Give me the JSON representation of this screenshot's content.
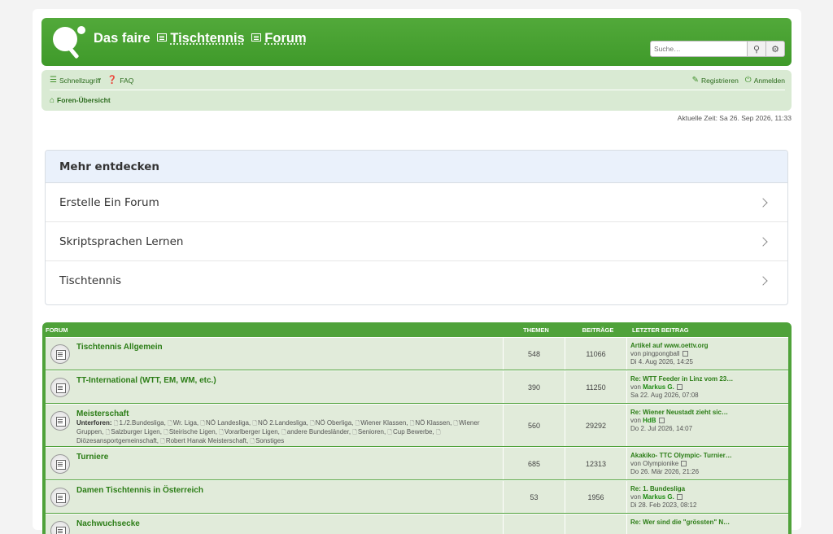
{
  "header": {
    "title_part1": "Das faire",
    "title_part2": "Tischtennis",
    "title_part3": "Forum",
    "search_placeholder": "Suche…"
  },
  "nav": {
    "quicklinks": "Schnellzugriff",
    "faq": "FAQ",
    "register": "Registrieren",
    "login": "Anmelden",
    "breadcrumb": "Foren-Übersicht"
  },
  "current_time": "Aktuelle Zeit: Sa 26. Sep 2026, 11:33",
  "discover": {
    "title": "Mehr entdecken",
    "items": [
      "Erstelle Ein Forum",
      "Skriptsprachen Lernen",
      "Tischtennis"
    ]
  },
  "forum_table": {
    "headers": {
      "forum": "Forum",
      "topics": "Themen",
      "posts": "Beiträge",
      "last": "Letzter Beitrag"
    },
    "rows": [
      {
        "title": "Tischtennis Allgemein",
        "topics": "548",
        "posts": "11066",
        "last_title": "Artikel auf www.oettv.org",
        "by": "von",
        "author": "pingpongball",
        "author_bold": false,
        "date": "Di 4. Aug 2026, 14:25"
      },
      {
        "title": "TT-International (WTT, EM, WM, etc.)",
        "topics": "390",
        "posts": "11250",
        "last_title": "Re: WTT Feeder in Linz vom 23…",
        "by": "von",
        "author": "Markus G.",
        "author_bold": true,
        "date": "Sa 22. Aug 2026, 07:08"
      },
      {
        "title": "Meisterschaft",
        "subforums_label": "Unterforen:",
        "subforums": [
          "1./2.Bundesliga",
          "Wr. Liga",
          "NÖ Landesliga",
          "NÖ 2.Landesliga",
          "NÖ Oberliga",
          "Wiener Klassen",
          "NÖ Klassen",
          "Wiener Gruppen",
          "Salzburger Ligen",
          "Steirische Ligen",
          "Vorarlberger Ligen",
          "andere Bundesländer",
          "Senioren",
          "Cup Bewerbe",
          "Diözesansportgemeinschaft",
          "Robert Hanak Meisterschaft",
          "Sonstiges"
        ],
        "topics": "560",
        "posts": "29292",
        "last_title": "Re: Wiener Neustadt zieht sic…",
        "by": "von",
        "author": "HdB",
        "author_bold": true,
        "date": "Do 2. Jul 2026, 14:07"
      },
      {
        "title": "Turniere",
        "topics": "685",
        "posts": "12313",
        "last_title": "Akakiko- TTC Olympic- Turnier…",
        "by": "von",
        "author": "Olympionike",
        "author_bold": false,
        "date": "Do 26. Mär 2026, 21:26"
      },
      {
        "title": "Damen Tischtennis in Österreich",
        "topics": "53",
        "posts": "1956",
        "last_title": "Re: 1. Bundesliga",
        "by": "von",
        "author": "Markus G.",
        "author_bold": true,
        "date": "Di 28. Feb 2023, 08:12"
      },
      {
        "title": "Nachwuchsecke",
        "topics": "",
        "posts": "",
        "last_title": "Re: Wer sind die \"grössten\" N…",
        "by": "",
        "author": "",
        "author_bold": false,
        "date": ""
      }
    ]
  },
  "colors": {
    "brand_green": "#4fa23a",
    "nav_bg": "#d9ead3",
    "row_bg": "#e1ebda",
    "link_green": "#2b7d16"
  }
}
